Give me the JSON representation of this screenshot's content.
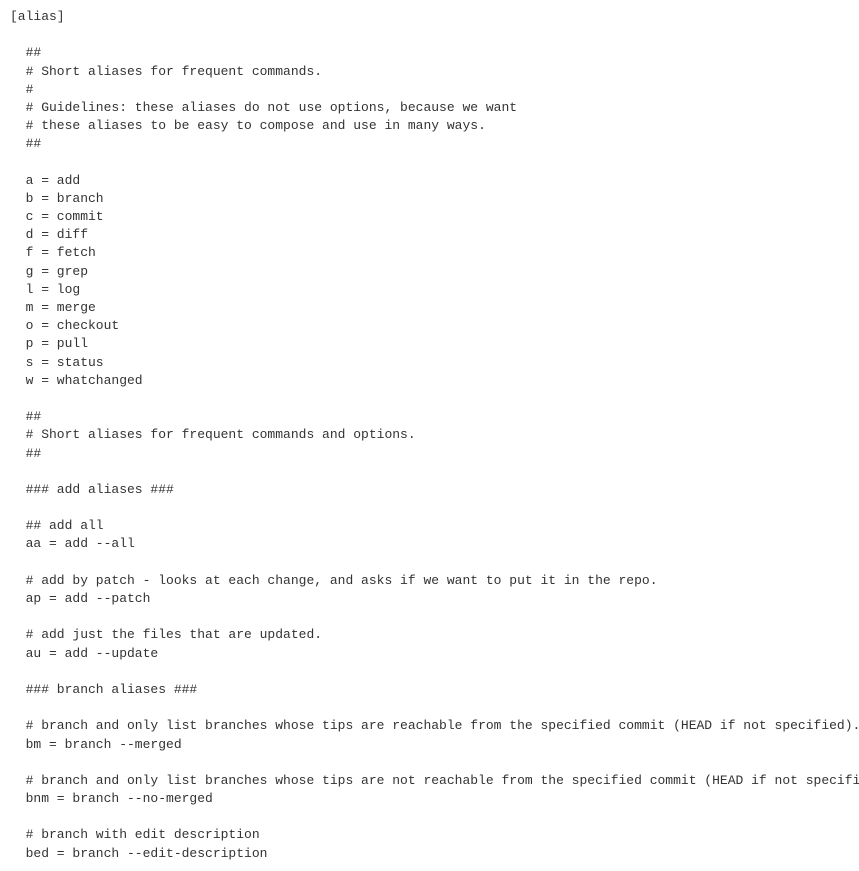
{
  "lines": [
    {
      "text": "[alias]",
      "indent": false
    },
    {
      "text": "",
      "indent": false
    },
    {
      "text": "##",
      "indent": true
    },
    {
      "text": "# Short aliases for frequent commands.",
      "indent": true
    },
    {
      "text": "#",
      "indent": true
    },
    {
      "text": "# Guidelines: these aliases do not use options, because we want",
      "indent": true
    },
    {
      "text": "# these aliases to be easy to compose and use in many ways.",
      "indent": true
    },
    {
      "text": "##",
      "indent": true
    },
    {
      "text": "",
      "indent": false
    },
    {
      "text": "a = add",
      "indent": true
    },
    {
      "text": "b = branch",
      "indent": true
    },
    {
      "text": "c = commit",
      "indent": true
    },
    {
      "text": "d = diff",
      "indent": true
    },
    {
      "text": "f = fetch",
      "indent": true
    },
    {
      "text": "g = grep",
      "indent": true
    },
    {
      "text": "l = log",
      "indent": true
    },
    {
      "text": "m = merge",
      "indent": true
    },
    {
      "text": "o = checkout",
      "indent": true
    },
    {
      "text": "p = pull",
      "indent": true
    },
    {
      "text": "s = status",
      "indent": true
    },
    {
      "text": "w = whatchanged",
      "indent": true
    },
    {
      "text": "",
      "indent": false
    },
    {
      "text": "##",
      "indent": true
    },
    {
      "text": "# Short aliases for frequent commands and options.",
      "indent": true
    },
    {
      "text": "##",
      "indent": true
    },
    {
      "text": "",
      "indent": false
    },
    {
      "text": "### add aliases ###",
      "indent": true
    },
    {
      "text": "",
      "indent": false
    },
    {
      "text": "## add all",
      "indent": true
    },
    {
      "text": "aa = add --all",
      "indent": true
    },
    {
      "text": "",
      "indent": false
    },
    {
      "text": "# add by patch - looks at each change, and asks if we want to put it in the repo.",
      "indent": true
    },
    {
      "text": "ap = add --patch",
      "indent": true
    },
    {
      "text": "",
      "indent": false
    },
    {
      "text": "# add just the files that are updated.",
      "indent": true
    },
    {
      "text": "au = add --update",
      "indent": true
    },
    {
      "text": "",
      "indent": false
    },
    {
      "text": "### branch aliases ###",
      "indent": true
    },
    {
      "text": "",
      "indent": false
    },
    {
      "text": "# branch and only list branches whose tips are reachable from the specified commit (HEAD if not specified).",
      "indent": true
    },
    {
      "text": "bm = branch --merged",
      "indent": true
    },
    {
      "text": "",
      "indent": false
    },
    {
      "text": "# branch and only list branches whose tips are not reachable from the specified commit (HEAD if not specified).",
      "indent": true
    },
    {
      "text": "bnm = branch --no-merged",
      "indent": true
    },
    {
      "text": "",
      "indent": false
    },
    {
      "text": "# branch with edit description",
      "indent": true
    },
    {
      "text": "bed = branch --edit-description",
      "indent": true
    }
  ]
}
